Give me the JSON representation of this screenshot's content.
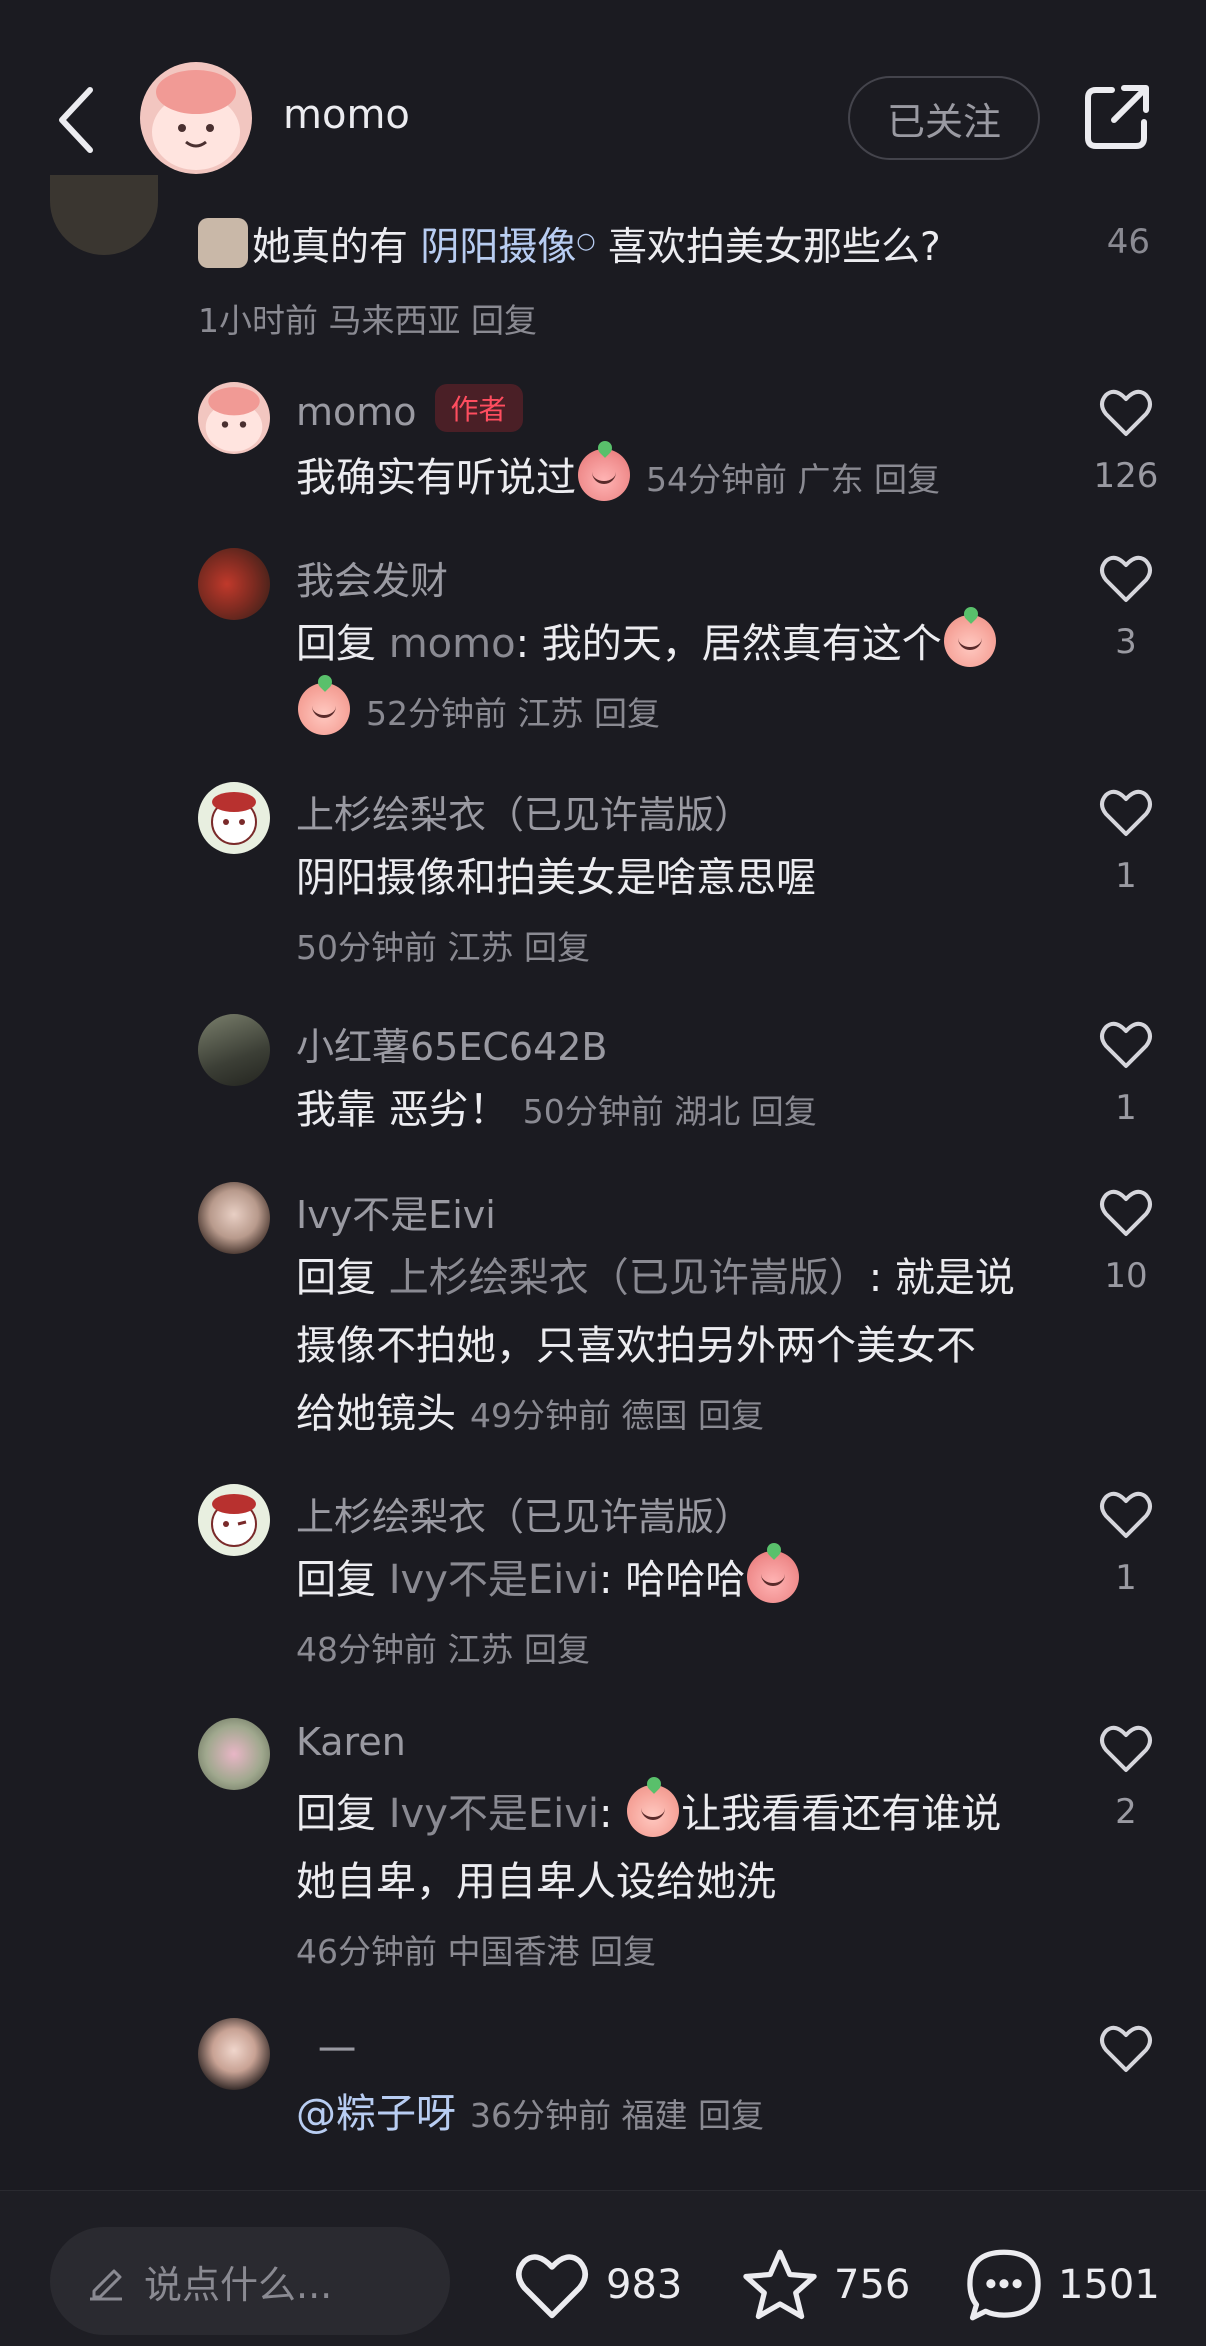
{
  "header": {
    "username": "momo",
    "follow_label": "已关注"
  },
  "top_comment": {
    "text_before": "她真的有 ",
    "link_text": "阴阳摄像",
    "text_after": " 喜欢拍美女那些么?",
    "meta": "1小时前 马来西亚 回复",
    "likes": "46"
  },
  "replies": [
    {
      "name": "momo",
      "tag": "作者",
      "line1_text": "我确实有听说过",
      "line1_meta": "54分钟前 广东 回复",
      "likes": "126"
    },
    {
      "name": "我会发财",
      "reply_prefix": "回复 ",
      "reply_target": "momo",
      "reply_text": ": 我的天，居然真有这个",
      "line2_meta": "52分钟前 江苏 回复",
      "likes": "3"
    },
    {
      "name": "上杉绘梨衣（已见许嵩版）",
      "line1_text": "阴阳摄像和拍美女是啥意思喔",
      "line2_meta": "50分钟前 江苏 回复",
      "likes": "1"
    },
    {
      "name": "小红薯65EC642B",
      "line1_text": "我靠 恶劣！",
      "line1_meta": "50分钟前 湖北 回复",
      "likes": "1"
    },
    {
      "name": "Ivy不是Eivi",
      "reply_prefix": "回复 ",
      "reply_target": "上杉绘梨衣（已见许嵩版）",
      "reply_text": ": 就是说",
      "line2_text": "摄像不拍她，只喜欢拍另外两个美女不",
      "line3_text": "给她镜头",
      "line3_meta": "49分钟前 德国 回复",
      "likes": "10"
    },
    {
      "name": "上杉绘梨衣（已见许嵩版）",
      "reply_prefix": "回复 ",
      "reply_target": "Ivy不是Eivi",
      "reply_text": ": 哈哈哈",
      "line2_meta": "48分钟前 江苏 回复",
      "likes": "1"
    },
    {
      "name": "Karen",
      "reply_prefix": "回复 ",
      "reply_target": "Ivy不是Eivi",
      "reply_text": "让我看看还有谁说",
      "line2_text": "她自卑，用自卑人设给她洗",
      "line3_meta": "46分钟前 中国香港 回复",
      "likes": "2"
    },
    {
      "name": "一",
      "mention": "@粽子呀",
      "line1_meta": "36分钟前 福建 回复",
      "likes": ""
    }
  ],
  "bottom_bar": {
    "input_placeholder": "说点什么...",
    "likes": "983",
    "favorites": "756",
    "comments": "1501"
  },
  "colors": {
    "background": "#1b1b21",
    "link": "#b8cdf2",
    "author_tag": "#ff4d5f",
    "meta": "#8a8a92"
  }
}
